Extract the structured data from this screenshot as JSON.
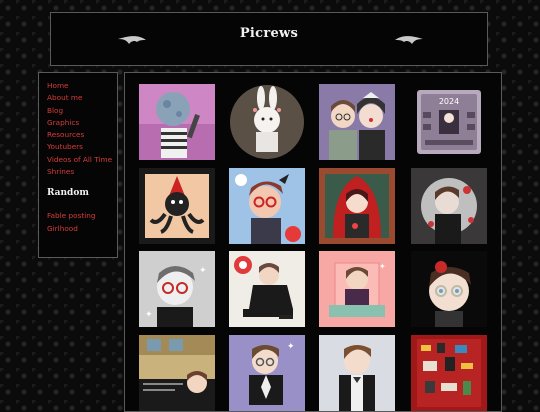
{
  "header": {
    "title": "Picrews"
  },
  "sidebar": {
    "links": [
      "Home",
      "About me",
      "Blog",
      "Graphics",
      "Resources",
      "Youtubers",
      "Videos of All Time",
      "Shrines"
    ],
    "random_title": "Random",
    "random_links": [
      "Fable posting",
      "Girlhood"
    ]
  },
  "gallery": {
    "item_count": 16
  }
}
